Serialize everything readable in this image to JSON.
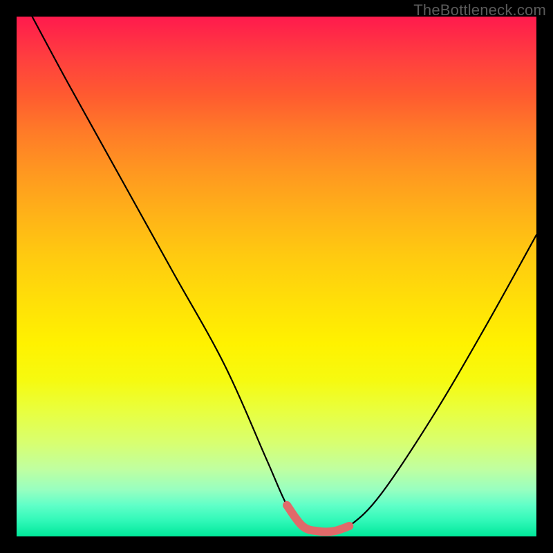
{
  "watermark": "TheBottleneck.com",
  "chart_data": {
    "type": "line",
    "title": "",
    "xlabel": "",
    "ylabel": "",
    "xlim": [
      0,
      100
    ],
    "ylim": [
      0,
      100
    ],
    "grid": false,
    "series": [
      {
        "name": "bottleneck-curve",
        "color": "#000000",
        "x": [
          3,
          10,
          20,
          30,
          40,
          48,
          52,
          55,
          58,
          61,
          64,
          70,
          80,
          90,
          100
        ],
        "y": [
          100,
          87,
          69,
          51,
          33,
          15,
          6,
          2,
          1,
          1,
          2,
          8,
          23,
          40,
          58
        ]
      },
      {
        "name": "optimal-region",
        "color": "#e06a6a",
        "x": [
          52,
          55,
          58,
          61,
          64
        ],
        "y": [
          6,
          2,
          1,
          1,
          2
        ]
      }
    ],
    "annotations": []
  }
}
